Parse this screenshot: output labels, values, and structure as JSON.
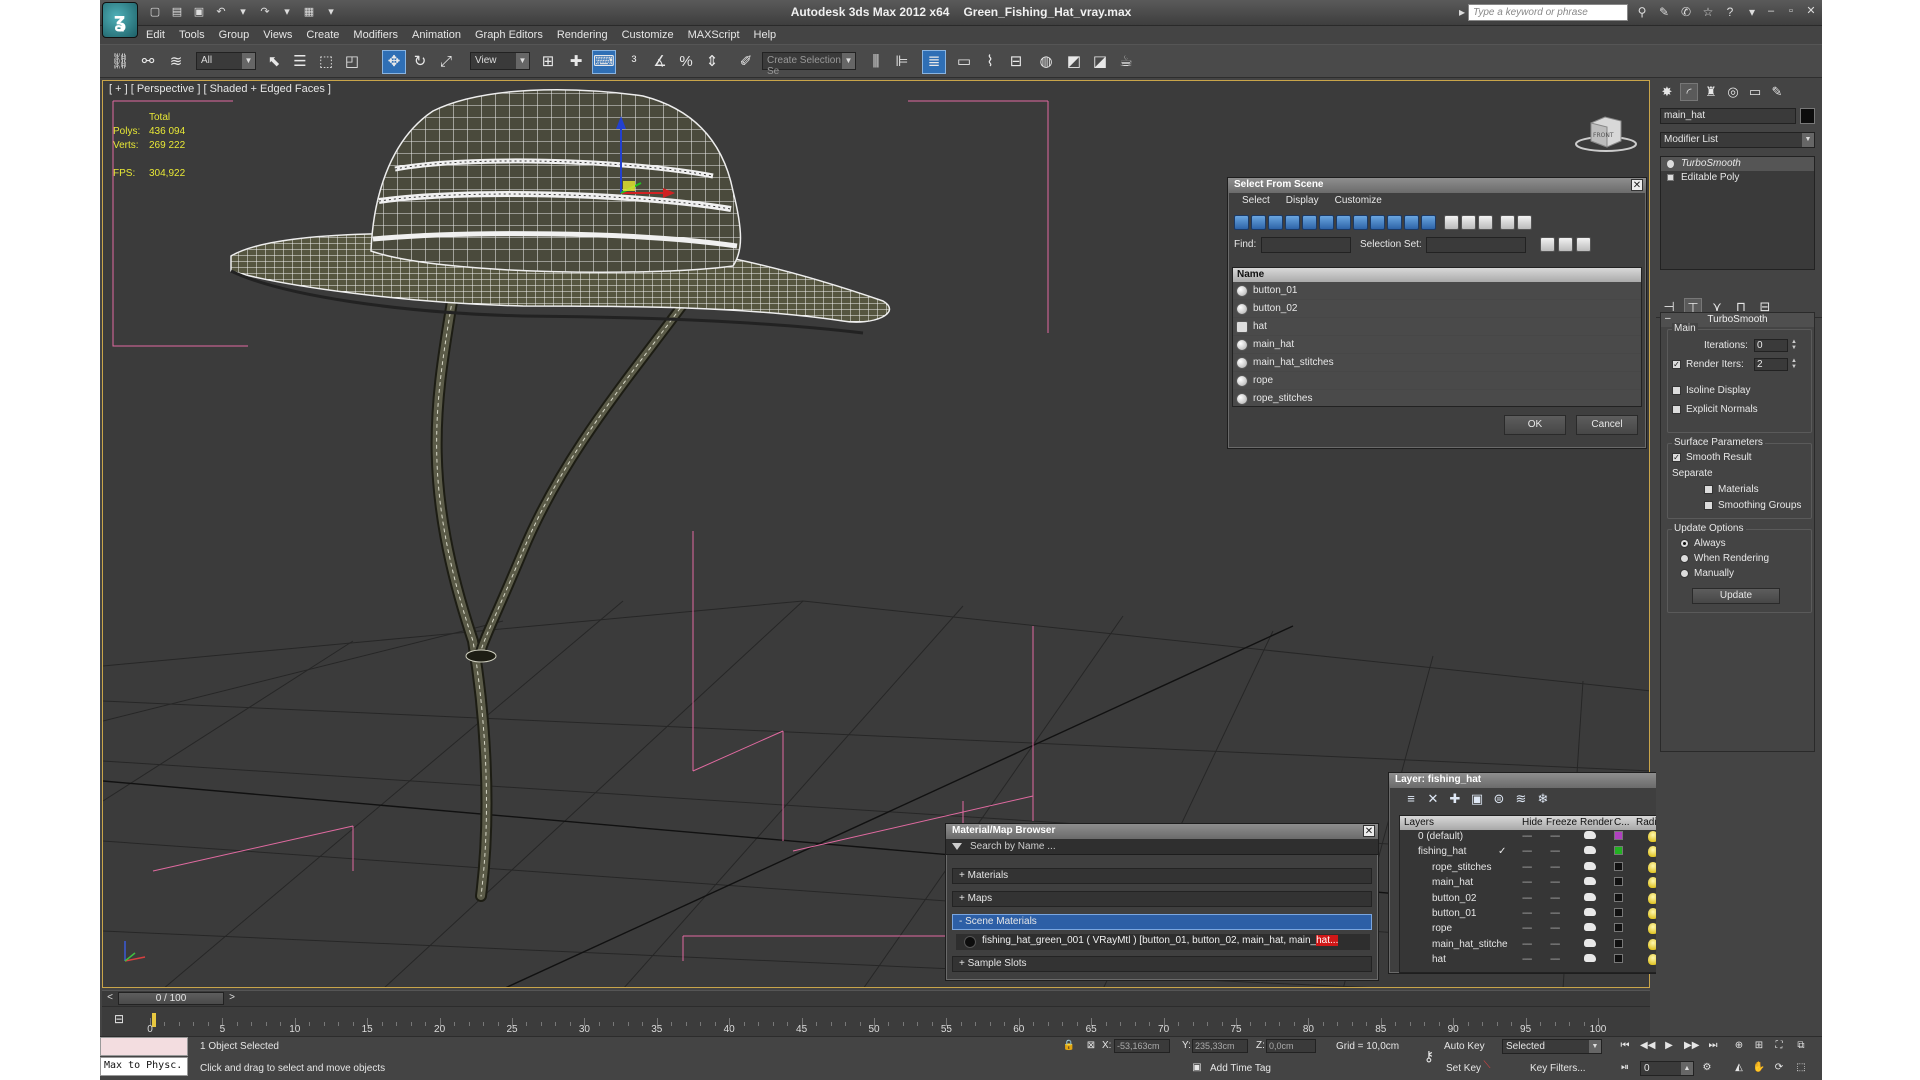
{
  "window": {
    "app_title": "Autodesk 3ds Max  2012 x64",
    "file_title": "Green_Fishing_Hat_vray.max",
    "search_placeholder": "Type a keyword or phrase"
  },
  "menu": [
    "Edit",
    "Tools",
    "Group",
    "Views",
    "Create",
    "Modifiers",
    "Animation",
    "Graph Editors",
    "Rendering",
    "Customize",
    "MAXScript",
    "Help"
  ],
  "toolbar": {
    "selection_filter": "All",
    "ref_coord": "View",
    "named_selection_placeholder": "Create Selection Se"
  },
  "viewport": {
    "label": "[ + ] [ Perspective ] [ Shaded + Edged Faces ]",
    "stats": {
      "header": "Total",
      "polys_label": "Polys:",
      "polys": "436 094",
      "verts_label": "Verts:",
      "verts": "269 222",
      "fps_label": "FPS:",
      "fps": "304,922"
    },
    "viewcube_label": "FRONT"
  },
  "select_from_scene": {
    "title": "Select From Scene",
    "menu": [
      "Select",
      "Display",
      "Customize"
    ],
    "find_label": "Find:",
    "selection_set_label": "Selection Set:",
    "column_name": "Name",
    "items": [
      "button_01",
      "button_02",
      "hat",
      "main_hat",
      "main_hat_stitches",
      "rope",
      "rope_stitches"
    ],
    "ok": "OK",
    "cancel": "Cancel"
  },
  "material_browser": {
    "title": "Material/Map Browser",
    "search_placeholder": "Search by Name ...",
    "categories": {
      "materials": "+ Materials",
      "maps": "+ Maps",
      "scene_materials": "- Scene Materials",
      "sample_slots": "+ Sample Slots"
    },
    "scene_material_row": "fishing_hat_green_001  ( VRayMtl )  [button_01, button_02, main_hat, main_",
    "scene_material_row_highlight": "hat..."
  },
  "layer_manager": {
    "title": "Layer: fishing_hat",
    "help": "?",
    "columns": [
      "Layers",
      "Hide",
      "Freeze",
      "Render",
      "C...",
      "Radiosity"
    ],
    "rows": [
      {
        "name": "0 (default)",
        "check": "",
        "color": "#b040c0"
      },
      {
        "name": "fishing_hat",
        "check": "✓",
        "color": "#22b022"
      },
      {
        "name": "rope_stitches",
        "check": "",
        "color": "#111111"
      },
      {
        "name": "main_hat",
        "check": "",
        "color": "#111111"
      },
      {
        "name": "button_02",
        "check": "",
        "color": "#111111"
      },
      {
        "name": "button_01",
        "check": "",
        "color": "#111111"
      },
      {
        "name": "rope",
        "check": "",
        "color": "#111111"
      },
      {
        "name": "main_hat_stitche",
        "check": "",
        "color": "#111111"
      },
      {
        "name": "hat",
        "check": "",
        "color": "#111111"
      }
    ],
    "dash": "----"
  },
  "command_panel": {
    "object_name": "main_hat",
    "modifier_list": "Modifier List",
    "stack": [
      "TurboSmooth",
      "Editable Poly"
    ],
    "rollout_title": "TurboSmooth",
    "main_group": "Main",
    "iterations_label": "Iterations:",
    "iterations": "0",
    "render_iters_label": "Render Iters:",
    "render_iters": "2",
    "isoline_display": "Isoline Display",
    "explicit_normals": "Explicit Normals",
    "surface_params": "Surface Parameters",
    "smooth_result": "Smooth Result",
    "separate": "Separate",
    "materials": "Materials",
    "smoothing_groups": "Smoothing Groups",
    "update_options": "Update Options",
    "always": "Always",
    "when_rendering": "When Rendering",
    "manually": "Manually",
    "update_button": "Update"
  },
  "timeline": {
    "frame": "0 / 100",
    "ticks": [
      "0",
      "5",
      "10",
      "15",
      "20",
      "25",
      "30",
      "35",
      "40",
      "45",
      "50",
      "55",
      "60",
      "65",
      "70",
      "75",
      "80",
      "85",
      "90",
      "95",
      "100"
    ]
  },
  "status": {
    "maxscript_top": "",
    "maxscript_bottom": "Max to Physc.",
    "selection": "1 Object Selected",
    "prompt": "Click and drag to select and move objects",
    "x_label": "X:",
    "x": "-53,163cm",
    "y_label": "Y:",
    "y": "235,33cm",
    "z_label": "Z:",
    "z": "0,0cm",
    "grid": "Grid = 10,0cm",
    "add_time_tag": "Add Time Tag",
    "auto_key": "Auto Key",
    "set_key": "Set Key",
    "selected": "Selected",
    "key_filters": "Key Filters...",
    "frame_field": "0"
  }
}
